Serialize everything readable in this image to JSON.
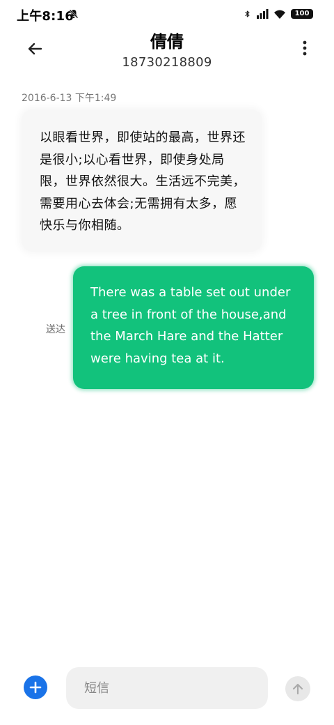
{
  "status_bar": {
    "time": "上午8:16",
    "battery": "100",
    "icons": [
      "mute-icon",
      "bluetooth-icon",
      "signal-icon",
      "wifi-icon",
      "battery-icon"
    ]
  },
  "header": {
    "contact_name": "倩倩",
    "contact_number": "18730218809",
    "icons": [
      "back-arrow-icon",
      "more-vertical-icon"
    ]
  },
  "conversation": {
    "timestamp": "2016-6-13 下午1:49",
    "messages": [
      {
        "direction": "incoming",
        "text": "以眼看世界，即使站的最高，世界还是很小;以心看世界，即使身处局限，世界依然很大。生活远不完美，需要用心去体会;无需拥有太多，愿快乐与你相随。"
      },
      {
        "direction": "outgoing",
        "text": "There was a table set out under a tree in front of the house,and the March Hare and the Hatter were having tea at it.",
        "status": "送达"
      }
    ]
  },
  "compose": {
    "placeholder": "短信",
    "value": "",
    "icons": [
      "plus-icon",
      "arrow-up-icon"
    ]
  },
  "colors": {
    "outgoing_bubble": "#12c27c",
    "incoming_bubble": "#f7f7f7",
    "add_button": "#1a73e8",
    "send_button": "#e8e8e8"
  }
}
